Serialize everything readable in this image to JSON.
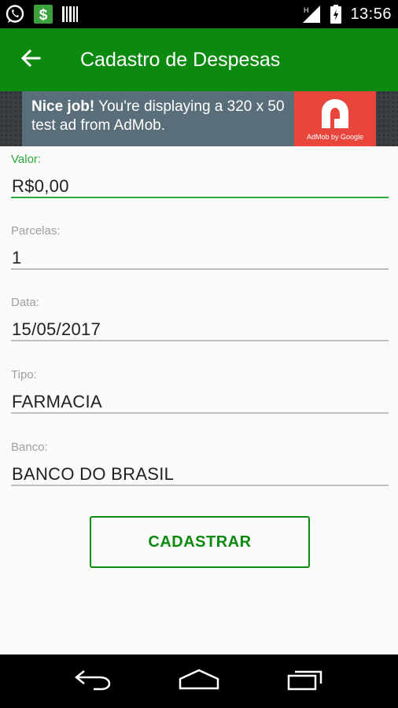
{
  "status_bar": {
    "time": "13:56",
    "icons": [
      "whatsapp-icon",
      "dollar-icon",
      "barcode-icon",
      "signal-icon",
      "battery-icon"
    ]
  },
  "app_bar": {
    "title": "Cadastro de Despesas",
    "back_icon": "arrow-back-icon",
    "color": "#0c8a0f"
  },
  "ad": {
    "bold_text": "Nice job!",
    "text": " You're displaying a 320 x 50 test ad from AdMob.",
    "logo_caption": "AdMob by Google"
  },
  "form": {
    "valor": {
      "label": "Valor:",
      "value": "R$0,00"
    },
    "parcelas": {
      "label": "Parcelas:",
      "value": "1"
    },
    "data": {
      "label": "Data:",
      "value": "15/05/2017"
    },
    "tipo": {
      "label": "Tipo:",
      "value": "FARMACIA"
    },
    "banco": {
      "label": "Banco:",
      "value": "BANCO DO BRASIL"
    },
    "accent_color": "#2eaa3a"
  },
  "submit": {
    "label": "CADASTRAR"
  },
  "nav_bar": {
    "icons": [
      "back-nav-icon",
      "home-nav-icon",
      "recents-nav-icon"
    ]
  }
}
